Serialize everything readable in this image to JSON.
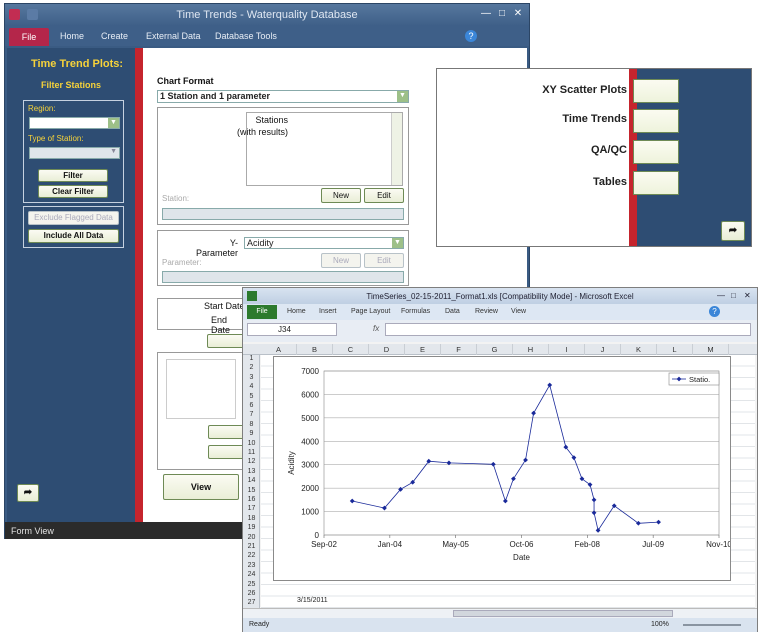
{
  "access": {
    "title": "Time Trends  -  Waterquality Database",
    "tabs": [
      "File",
      "Home",
      "Create",
      "External Data",
      "Database Tools"
    ],
    "status": "Form View",
    "left_panel": {
      "title": "Time Trend Plots:",
      "subtitle": "Filter Stations",
      "region_label": "Region:",
      "type_label": "Type of Station:",
      "filter_btn": "Filter",
      "clear_btn": "Clear Filter",
      "exclude_btn": "Exclude Flagged Data",
      "include_btn": "Include All Data"
    },
    "main": {
      "chart_format_label": "Chart Format",
      "chart_format_value": "1 Station and 1 parameter",
      "stations_label_1": "Stations",
      "stations_label_2": "(with results)",
      "station_label": "Station:",
      "new_btn": "New",
      "edit_btn": "Edit",
      "y_param_label": "Y-Parameter",
      "y_param_value": "Acidity",
      "parameter_label": "Parameter:",
      "start_date_label": "Start Date",
      "end_date_label": "End Date",
      "view_btn": "View"
    }
  },
  "switchboard": {
    "items": [
      "XY Scatter Plots",
      "Time Trends",
      "QA/QC",
      "Tables"
    ]
  },
  "excel": {
    "title": "TimeSeries_02-15-2011_Format1.xls  [Compatibility Mode]  -  Microsoft Excel",
    "tabs": [
      "File",
      "Home",
      "Insert",
      "Page Layout",
      "Formulas",
      "Data",
      "Review",
      "View"
    ],
    "name_box": "J34",
    "fx": "fx",
    "columns": [
      "A",
      "B",
      "C",
      "D",
      "E",
      "F",
      "G",
      "H",
      "I",
      "J",
      "K",
      "L",
      "M"
    ],
    "rows": [
      "1",
      "2",
      "3",
      "4",
      "5",
      "6",
      "7",
      "8",
      "9",
      "10",
      "11",
      "12",
      "13",
      "14",
      "15",
      "16",
      "17",
      "18",
      "19",
      "20",
      "21",
      "22",
      "23",
      "24",
      "25",
      "26",
      "27"
    ],
    "cell_a26": "3/15/2011",
    "status": "Ready",
    "zoom": "100%"
  },
  "chart_data": {
    "type": "line",
    "ylabel": "Acidity",
    "xlabel": "Date",
    "ylim": [
      0,
      7000
    ],
    "yticks": [
      "0",
      "1000",
      "2000",
      "3000",
      "4000",
      "5000",
      "6000",
      "7000"
    ],
    "xticks": [
      "Sep-02",
      "Jan-04",
      "May-05",
      "Oct-06",
      "Feb-08",
      "Jul-09",
      "Nov-10"
    ],
    "legend": "top-right",
    "grid": true,
    "series": [
      {
        "name": "Statio.",
        "color": "#1a2a9a",
        "x": [
          "2003-04",
          "2003-12",
          "2004-04",
          "2004-07",
          "2004-11",
          "2005-04",
          "2006-03",
          "2006-06",
          "2006-08",
          "2006-11",
          "2007-01",
          "2007-05",
          "2007-09",
          "2007-11",
          "2008-01",
          "2008-03",
          "2008-04",
          "2008-04",
          "2008-05",
          "2008-09",
          "2009-03",
          "2009-08"
        ],
        "values": [
          1450,
          1150,
          1950,
          2250,
          3150,
          3080,
          3020,
          1450,
          2400,
          3200,
          5200,
          6400,
          3750,
          3300,
          2400,
          2150,
          1500,
          950,
          200,
          1250,
          500,
          550
        ]
      }
    ]
  }
}
